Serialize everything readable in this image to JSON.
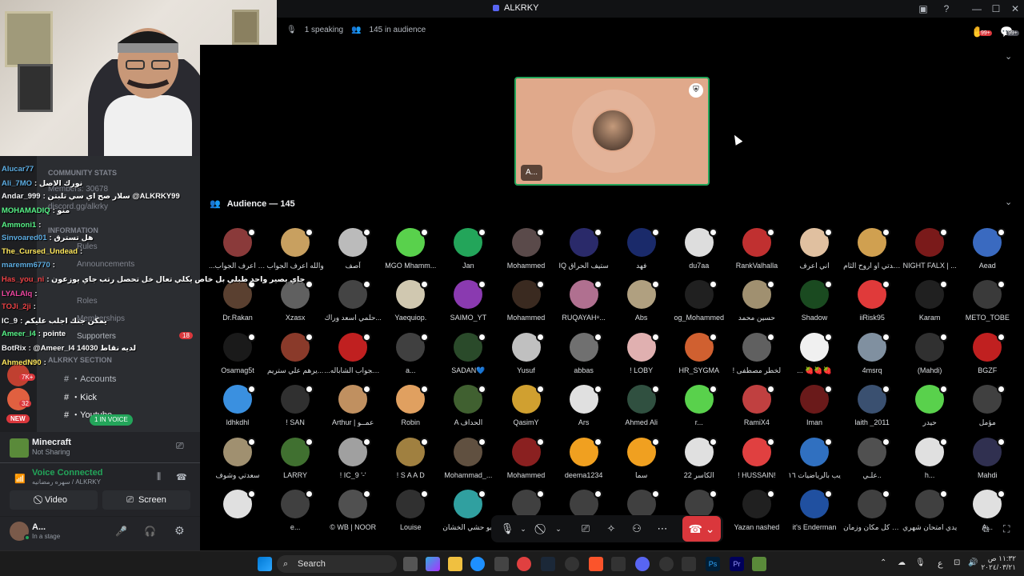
{
  "window": {
    "title": "ALKRKY"
  },
  "stage": {
    "speaking": "1 speaking",
    "audience_count": "145 in audience",
    "speaker_tag": "A...",
    "audience_header": "Audience — 145",
    "notif_badge": "99+"
  },
  "sidebar": {
    "sections": {
      "community_stats": "COMMUNITY STATS",
      "members": "Members: 30678",
      "invite": "discord.gg/alkrky",
      "information": "INFORMATION",
      "rules": "Rules",
      "announcements": "Announcements",
      "roles": "Roles",
      "memberships": "Memberships",
      "supporters": "Supporters",
      "supporters_badge": "18",
      "section": "ALKRKY SECTION",
      "accounts": "・Accounts",
      "kick": "・Kick",
      "youtube": "・Youtube"
    },
    "server_badges": [
      "7K+",
      "32",
      "NEW"
    ],
    "in_voice": "1 IN VOICE"
  },
  "chat": [
    {
      "name": "Alucar77",
      "text": "",
      "color": "#5dade2"
    },
    {
      "name": "Ali_7MO",
      "text": ": ﻧﻮرك اﻻﺻﻞ",
      "color": "#5dade2"
    },
    {
      "name": "Andar_999",
      "text": ": ﺳﻼر ﺻﺢ اي ﺳﻲ ﺗﻠﺒﺘﻦ @ALKRKY99",
      "color": "#f2f3f5"
    },
    {
      "name": "MOHAMADIQ",
      "text": ": ﻣﻨﻮ",
      "color": "#57f287"
    },
    {
      "name": "Ammoni1",
      "text": ":",
      "color": "#57f287"
    },
    {
      "name": "Sinvoared01",
      "text": ": ﻫﻞ ﺗﺴﺘﺮق",
      "color": "#5dade2"
    },
    {
      "name": "The_Cursed_Undead",
      "text": ":",
      "color": "#fee75c"
    },
    {
      "name": "maremm6770",
      "text": ":",
      "color": "#5dade2"
    },
    {
      "name": "Has_you_ni",
      "text": ": ﺟﺎي ﻳﺼﻴﺮ واﺣﺪ ﻃﺒﻠﻲ ﺑﻞ ﺧﺎص ﻳﻜﻠﻲ ﺗﻌﺎل ﺧﻞ ﺗﺤﺼﻞ رﺗﺐ ﺟﺎي ﻳﻮزﻋﻮن",
      "color": "#ed4245"
    },
    {
      "name": "LYALAIq",
      "text": ":",
      "color": "#eb459e"
    },
    {
      "name": "TOJi_2ji",
      "text": ":",
      "color": "#ed4245"
    },
    {
      "name": "IC_9",
      "text": ": ﻳﻤﻜﻦ ﺟﻨﻚ اﺟﻠﺐ ﻋﻠﻴﻜﻢ",
      "color": "#f2f3f5"
    },
    {
      "name": "Ameer_l4",
      "text": ": pointe",
      "color": "#57f287"
    },
    {
      "name": "BotRix",
      "text": ": @Ameer_l4 14030 ﻟﺪﻳﻪ ﻧﻘﺎط",
      "color": "#f2f3f5"
    },
    {
      "name": "AhmedN90",
      "text": ":",
      "color": "#fee75c"
    }
  ],
  "activity": {
    "game": "Minecraft",
    "status": "Not Sharing"
  },
  "voice": {
    "status": "Voice Connected",
    "channel": "ﺳﻬﺮه رﻣﻀﺎﻧﻴﻪ / ALKRKY"
  },
  "buttons": {
    "video": "Video",
    "screen": "Screen"
  },
  "user": {
    "name": "A...",
    "status": "In a stage"
  },
  "audience": [
    {
      "name": "...اﻗﺪ اﻋﺮف اﻟﺠﻮاب",
      "color": "#8a3a3a"
    },
    {
      "name": "واﻟﻠﻪ اﻋﺮف اﻟﺠﻮاب",
      "color": "#c8a060"
    },
    {
      "name": "آﺻﻒ",
      "color": "#bbbbbb"
    },
    {
      "name": "MGO Mhamm...",
      "color": "#59d14c"
    },
    {
      "name": "Jan",
      "color": "#23a55a"
    },
    {
      "name": "Mohammed",
      "color": "#5a4a4a"
    },
    {
      "name": "IQ ﺳﺘﻴﻒ اﻟﺤﺮاق",
      "color": "#2a2a6a"
    },
    {
      "name": "ﻓﻬﺪ",
      "color": "#1a2a6a"
    },
    {
      "name": "du7aa",
      "color": "#dddddd"
    },
    {
      "name": "RankValhalla",
      "color": "#c03030"
    },
    {
      "name": "اﻧﻲ اﻋﺮف",
      "color": "#e0c0a0"
    },
    {
      "name": "ﺳﻌﺪﺗﻲ او اروح اﻟﺜﺎم",
      "color": "#d0a050"
    },
    {
      "name": "NIGHT FALX | ...",
      "color": "#7a1a1a"
    },
    {
      "name": "Aead",
      "color": "#3a6ac0"
    },
    {
      "name": "Dr.Rakan",
      "color": "#5a4030"
    },
    {
      "name": "Xzasx",
      "color": "#606060"
    },
    {
      "name": "ﺣﻠﻤﻲ اﺳﻌﺪ وراك...",
      "color": "#444444"
    },
    {
      "name": "Yaequiop.",
      "color": "#d0c8b0"
    },
    {
      "name": "SAIMO_YT",
      "color": "#8a3ab0"
    },
    {
      "name": "Mohammed",
      "color": "#3a2a20"
    },
    {
      "name": "RUQAYAH⁸...",
      "color": "#b07090"
    },
    {
      "name": "Abs",
      "color": "#b0a080"
    },
    {
      "name": "og_Mohammed",
      "color": "#202020"
    },
    {
      "name": "ﺣﺴﻴﻦ ﻣﺤﻤﺪ",
      "color": "#a09070"
    },
    {
      "name": "Shadow",
      "color": "#1a4a20"
    },
    {
      "name": "iiRisk95",
      "color": "#e03a3a"
    },
    {
      "name": "Karam",
      "color": "#202020"
    },
    {
      "name": "METO_TOBE",
      "color": "#3a3a3a"
    },
    {
      "name": "Osamag5t",
      "color": "#1a1a1a"
    },
    {
      "name": "ﻳﺮﻫﻢ ﻋﻠﻲ ﺳﺘﺮﻳﻢ...",
      "color": "#8a3a2a"
    },
    {
      "name": "...ف اﻟﺠﻮاب اﻟﺸﺎﺑﺎﻟﻪ",
      "color": "#c02020"
    },
    {
      "name": "a...",
      "color": "#404040"
    },
    {
      "name": "SADAN💙",
      "color": "#2a4a2a"
    },
    {
      "name": "Yusuf",
      "color": "#c0c0c0"
    },
    {
      "name": "abbas",
      "color": "#707070"
    },
    {
      "name": "! LOBY",
      "color": "#e0b0b0"
    },
    {
      "name": "HR_SYGMA",
      "color": "#d06030"
    },
    {
      "name": "! ﻟﺨﻄﺮ ﻣﺼﻄﻔﻰ",
      "color": "#606060"
    },
    {
      "name": "... 🍓🍓🍓",
      "color": "#f0f0f0"
    },
    {
      "name": "4msrq",
      "color": "#8090a0"
    },
    {
      "name": "(Mahdi)",
      "color": "#303030"
    },
    {
      "name": "BGZF",
      "color": "#c02020"
    },
    {
      "name": "ldhkdhl",
      "color": "#3a90e0"
    },
    {
      "name": "! SAN",
      "color": "#303030"
    },
    {
      "name": "Arthur | ﻋﻤــﻮ",
      "color": "#c09060"
    },
    {
      "name": "Robin",
      "color": "#e0a060"
    },
    {
      "name": "A اﻟﺤﺪاف",
      "color": "#406030"
    },
    {
      "name": "QasimY",
      "color": "#d0a030"
    },
    {
      "name": "Ars",
      "color": "#e0e0e0"
    },
    {
      "name": "Ahmed Ali",
      "color": "#305040"
    },
    {
      "name": "r...",
      "color": "#59d14c"
    },
    {
      "name": "RamiX4",
      "color": "#c04040"
    },
    {
      "name": "Iman",
      "color": "#6a1a1a"
    },
    {
      "name": "laith _2011",
      "color": "#3a5070"
    },
    {
      "name": "ﺣﻴﺪر",
      "color": "#59d14c"
    },
    {
      "name": "ﻣﺆﻣﻞ",
      "color": "#404040"
    },
    {
      "name": "ﺳﻌﺪﺗﻲ وﺷﻮف",
      "color": "#a09070"
    },
    {
      "name": "LARRY",
      "color": "#407030"
    },
    {
      "name": "! IC_9 '-'",
      "color": "#a0a0a0"
    },
    {
      "name": "! S A A D",
      "color": "#a08040"
    },
    {
      "name": "Mohammad_...",
      "color": "#605040"
    },
    {
      "name": "Mohammed",
      "color": "#8a2020"
    },
    {
      "name": "deema1234",
      "color": "#f0a020"
    },
    {
      "name": "ﺳﻤﺎ",
      "color": "#f0a020"
    },
    {
      "name": "اﻟﻜﺎﺳﺮ 22",
      "color": "#e0e0e0"
    },
    {
      "name": "! HUSSAIN!",
      "color": "#e04040"
    },
    {
      "name": "ﻳﺐ ﺑﺎﻟﺮﻳﺎﺿﻴﺎت ١٦",
      "color": "#3070c0"
    },
    {
      "name": "ﻋﻠـﻲ..",
      "color": "#505050"
    },
    {
      "name": "h...",
      "color": "#e0e0e0"
    },
    {
      "name": "Mahdi",
      "color": "#303050"
    },
    {
      "name": "",
      "color": "#e0e0e0"
    },
    {
      "name": "e...",
      "color": "#404040"
    },
    {
      "name": "© WB | NOOR",
      "color": "#505050"
    },
    {
      "name": "Louise",
      "color": "#303030"
    },
    {
      "name": "اﺑﻮ ﺣﺸﻲ اﻟﺨﺸﺎن",
      "color": "#30a0a0"
    },
    {
      "name": "",
      "color": "#404040"
    },
    {
      "name": "",
      "color": "#404040"
    },
    {
      "name": "",
      "color": "#404040"
    },
    {
      "name": "",
      "color": "#404040"
    },
    {
      "name": "Yazan nashed",
      "color": "#202020"
    },
    {
      "name": "it's Enderman",
      "color": "#2050a0"
    },
    {
      "name": "ﺻﺒﺢ ﺑﺆ ﻛﻞ ﻣﻜﺎن وزﻣﺎن",
      "color": "#404040"
    },
    {
      "name": "ﻳﺪي اﻣﺘﺤﺎن ﺷﻬﺮي",
      "color": "#404040"
    },
    {
      "name": "A...",
      "color": "#e0e0e0"
    }
  ],
  "taskbar": {
    "search": "Search",
    "time": "١١:٣٢ ص",
    "date": "٢٠٢٤/٠٣/٢١",
    "lang": "ع"
  }
}
